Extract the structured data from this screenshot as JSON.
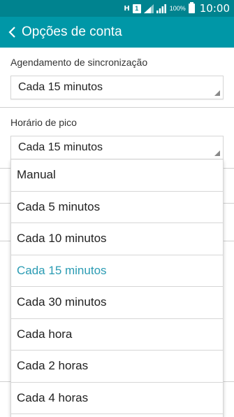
{
  "status_bar": {
    "h_indicator": "H",
    "sim_label": "1",
    "battery_percent": "100%",
    "time": "10:00",
    "color": "#00838f"
  },
  "app_bar": {
    "title": "Opções de conta",
    "back_icon": "chevron-left-icon",
    "color": "#0097a7"
  },
  "sync_schedule": {
    "label": "Agendamento de sincronização",
    "value": "Cada 15 minutos"
  },
  "peak_time": {
    "label": "Horário de pico",
    "value": "Cada 15 minutos"
  },
  "dropdown": {
    "selected_index": 3,
    "selected_color": "#2a9bb3",
    "options": [
      "Manual",
      "Cada 5 minutos",
      "Cada 10 minutos",
      "Cada 15 minutos",
      "Cada 30 minutos",
      "Cada hora",
      "Cada 2 horas",
      "Cada 4 horas"
    ]
  }
}
